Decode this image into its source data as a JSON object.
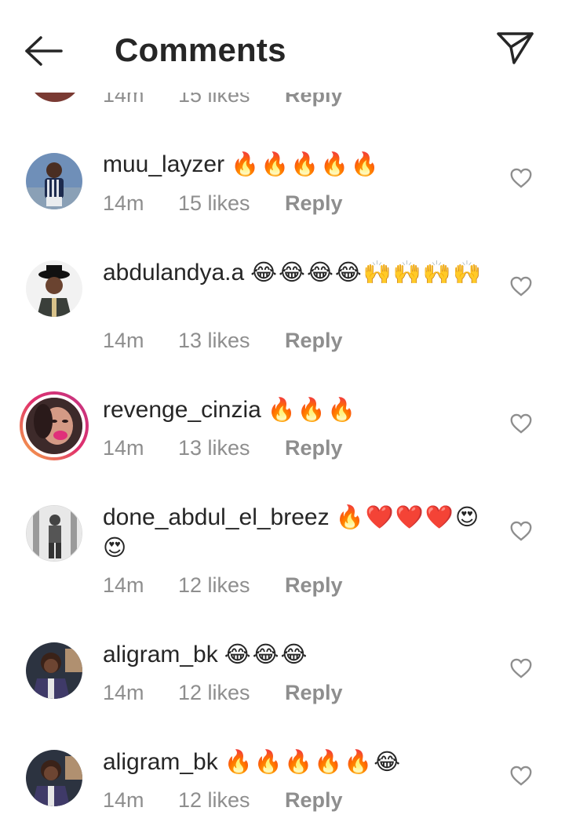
{
  "header": {
    "title": "Comments"
  },
  "partial_row": {
    "time": "14m",
    "likes": "15 likes",
    "reply": "Reply"
  },
  "comments": [
    {
      "username": "muu_layzer",
      "text": "🔥🔥🔥🔥🔥",
      "time": "14m",
      "likes": "15 likes",
      "reply": "Reply"
    },
    {
      "username": "abdulandya.a",
      "text": "😂😂😂😂🙌🙌🙌🙌",
      "time": "14m",
      "likes": "13 likes",
      "reply": "Reply"
    },
    {
      "username": "revenge_cinzia",
      "text": "🔥🔥🔥",
      "time": "14m",
      "likes": "13 likes",
      "reply": "Reply"
    },
    {
      "username": "done_abdul_el_breez",
      "text": "🔥❤️❤️❤️😍😍",
      "time": "14m",
      "likes": "12 likes",
      "reply": "Reply"
    },
    {
      "username": "aligram_bk",
      "text": "😂😂😂",
      "time": "14m",
      "likes": "12 likes",
      "reply": "Reply"
    },
    {
      "username": "aligram_bk",
      "text": "🔥🔥🔥🔥🔥😂",
      "time": "14m",
      "likes": "12 likes",
      "reply": "Reply"
    }
  ],
  "colors": {
    "text": "#262626",
    "secondary": "#8e8e8e",
    "story_ring_start": "#f7b044",
    "story_ring_end": "#c13584"
  },
  "icons": [
    "back-arrow-icon",
    "paper-plane-icon",
    "heart-outline-icon"
  ]
}
